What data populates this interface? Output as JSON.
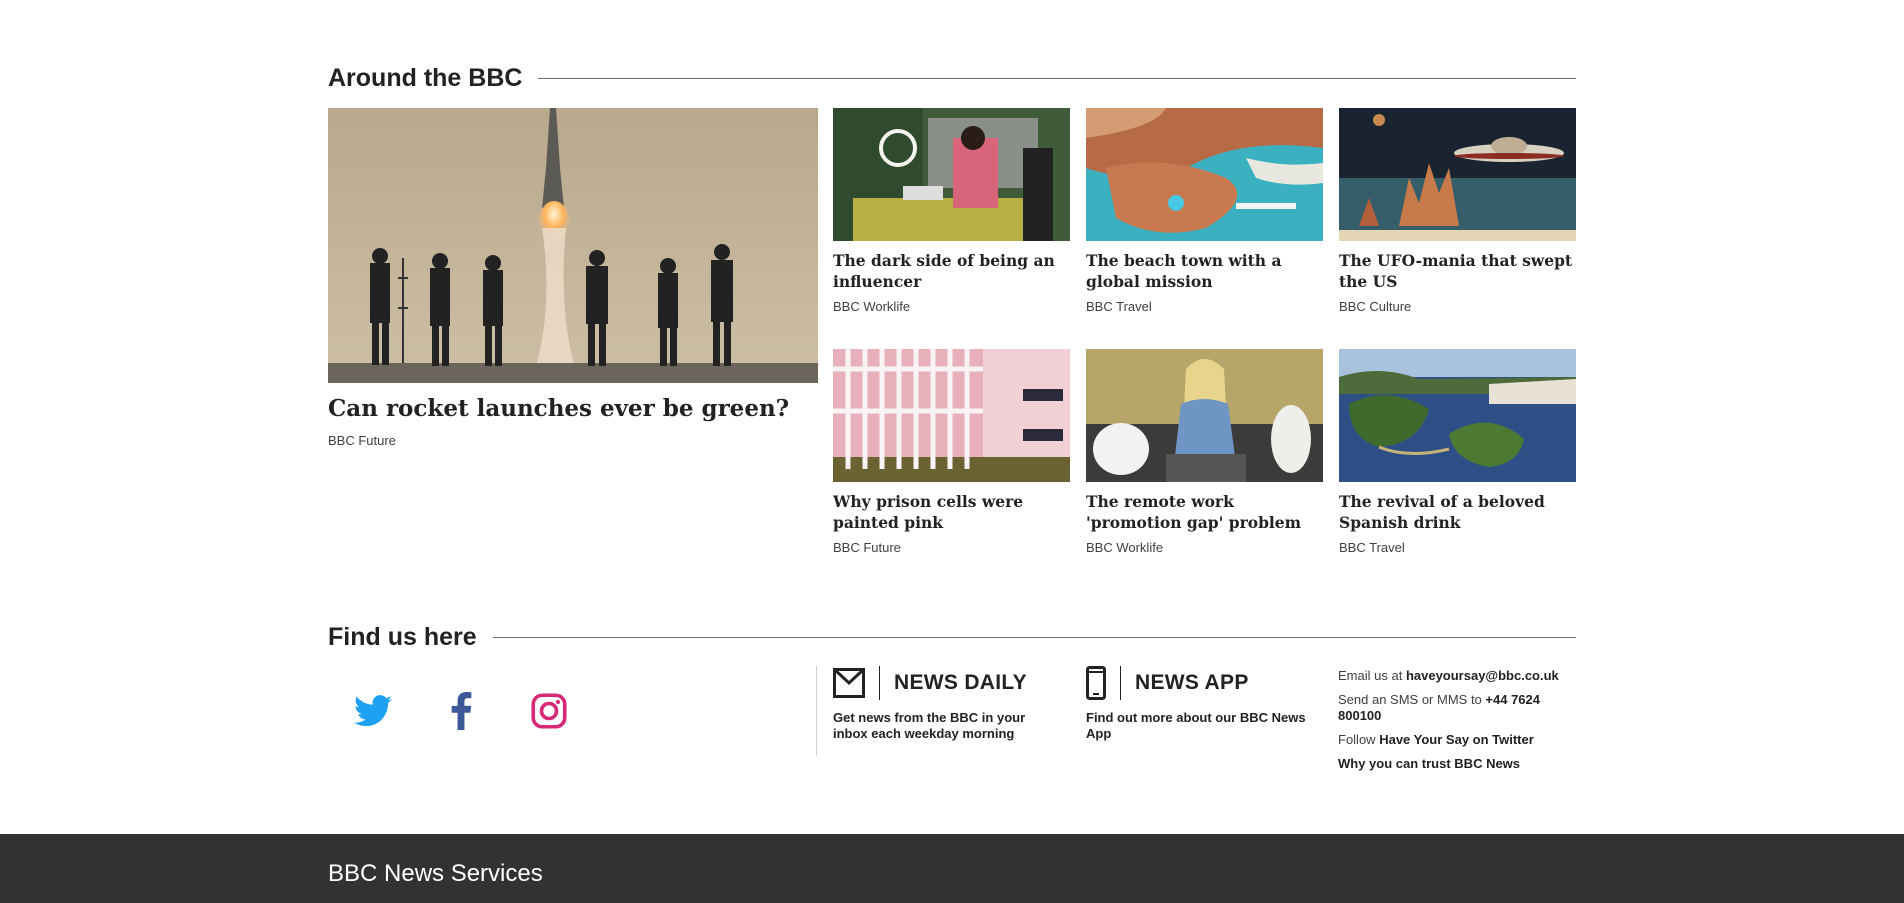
{
  "around": {
    "heading": "Around the BBC",
    "featured": {
      "title": "Can rocket launches ever be green?",
      "source": "BBC Future"
    },
    "cards": [
      {
        "title": "The dark side of being an influencer",
        "source": "BBC Worklife"
      },
      {
        "title": "The beach town with a global mission",
        "source": "BBC Travel"
      },
      {
        "title": "The UFO-mania that swept the US",
        "source": "BBC Culture"
      },
      {
        "title": "Why prison cells were painted pink",
        "source": "BBC Future"
      },
      {
        "title": "The remote work 'promotion gap' problem",
        "source": "BBC Worklife"
      },
      {
        "title": "The revival of a beloved Spanish drink",
        "source": "BBC Travel"
      }
    ]
  },
  "find": {
    "heading": "Find us here",
    "social_icons": [
      "twitter-icon",
      "facebook-icon",
      "instagram-icon"
    ],
    "social_colors": {
      "twitter": "#1da1f2",
      "facebook": "#3b5998",
      "instagram": "#d62976"
    },
    "news_daily": {
      "label": "NEWS DAILY",
      "description": "Get news from the BBC in your inbox each weekday morning",
      "icon": "envelope-icon"
    },
    "news_app": {
      "label": "NEWS APP",
      "description": "Find out more about our BBC News App",
      "icon": "mobile-phone-icon"
    },
    "contact": {
      "email_prefix": "Email us at",
      "email": "haveyoursay@bbc.co.uk",
      "sms_prefix": "Send an SMS or MMS to",
      "sms_number": "+44 7624 800100",
      "follow_prefix": "Follow",
      "twitter_link": "Have Your Say on Twitter",
      "trust_link": "Why you can trust BBC News"
    }
  },
  "footer": {
    "title": "BBC News Services"
  }
}
